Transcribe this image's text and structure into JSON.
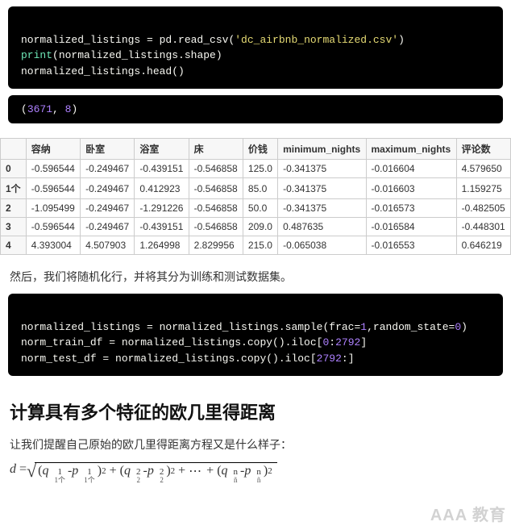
{
  "code1": {
    "l1a": "normalized_listings = pd.read_csv(",
    "l1b": "'dc_airbnb_normalized.csv'",
    "l1c": ")",
    "l2a": "print",
    "l2b": "(normalized_listings.shape)",
    "l3": "normalized_listings.head()"
  },
  "output1": {
    "open": "(",
    "n1": "3671",
    "comma": ", ",
    "n2": "8",
    "close": ")"
  },
  "table": {
    "headers": [
      "",
      "容纳",
      "卧室",
      "浴室",
      "床",
      "价钱",
      "minimum_nights",
      "maximum_nights",
      "评论数"
    ],
    "rows": [
      {
        "idx": "0",
        "cells": [
          "-0.596544",
          "-0.249467",
          "-0.439151",
          "-0.546858",
          "125.0",
          "-0.341375",
          "-0.016604",
          "4.579650"
        ]
      },
      {
        "idx": "1个",
        "cells": [
          "-0.596544",
          "-0.249467",
          "0.412923",
          "-0.546858",
          "85.0",
          "-0.341375",
          "-0.016603",
          "1.159275"
        ]
      },
      {
        "idx": "2",
        "cells": [
          "-1.095499",
          "-0.249467",
          "-1.291226",
          "-0.546858",
          "50.0",
          "-0.341375",
          "-0.016573",
          "-0.482505"
        ]
      },
      {
        "idx": "3",
        "cells": [
          "-0.596544",
          "-0.249467",
          "-0.439151",
          "-0.546858",
          "209.0",
          "0.487635",
          "-0.016584",
          "-0.448301"
        ]
      },
      {
        "idx": "4",
        "cells": [
          "4.393004",
          "4.507903",
          "1.264998",
          "2.829956",
          "215.0",
          "-0.065038",
          "-0.016553",
          "0.646219"
        ]
      }
    ]
  },
  "prose1": "然后，我们将随机化行，并将其分为训练和测试数据集。",
  "code2": {
    "l1a": "normalized_listings = normalized_listings.sample(frac=",
    "l1b": "1",
    "l1c": ",random_state=",
    "l1d": "0",
    "l1e": ")",
    "l2a": "norm_train_df = normalized_listings.copy().iloc[",
    "l2b": "0",
    "l2c": ":",
    "l2d": "2792",
    "l2e": "]",
    "l3a": "norm_test_df = normalized_listings.copy().iloc[",
    "l3b": "2792",
    "l3c": ":]"
  },
  "heading": "计算具有多个特征的欧几里得距离",
  "prose2": "让我们提醒自己原始的欧几里得距离方程又是什么样子：",
  "formula": {
    "d": "d",
    "eq": " = ",
    "q": "q",
    "p": "p",
    "minus": " - ",
    "plus": " + ",
    "dots": "⋯",
    "exp": "2",
    "i1t": "1",
    "i1b": "1个",
    "i2t": "2",
    "i2b": "2",
    "int": "n",
    "inb": "ñ"
  },
  "watermark": "AAA 教育"
}
